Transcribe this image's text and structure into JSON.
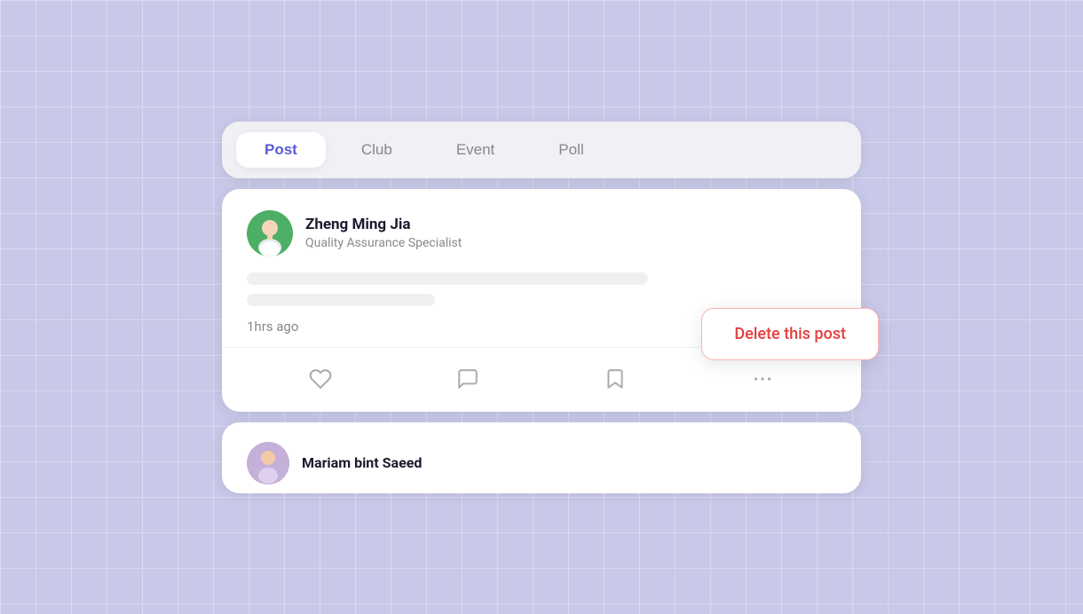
{
  "background": {
    "color": "#c8c8e8"
  },
  "tabs": {
    "items": [
      {
        "label": "Post",
        "active": true
      },
      {
        "label": "Club",
        "active": false
      },
      {
        "label": "Event",
        "active": false
      },
      {
        "label": "Poll",
        "active": false
      }
    ]
  },
  "post": {
    "author_name": "Zheng Ming Jia",
    "author_role": "Quality Assurance Specialist",
    "time_ago": "1hrs ago",
    "actions": {
      "like_label": "like",
      "comment_label": "comment",
      "bookmark_label": "bookmark",
      "more_label": "more"
    }
  },
  "delete_popup": {
    "label": "Delete this post"
  },
  "second_post": {
    "author_name": "Mariam bint Saeed"
  }
}
